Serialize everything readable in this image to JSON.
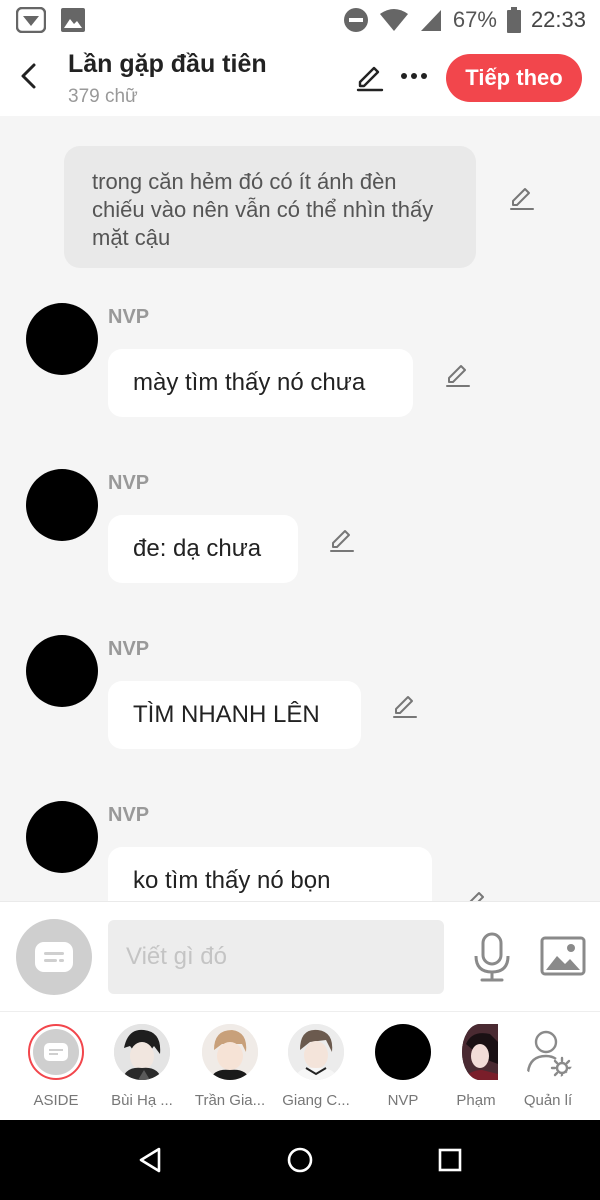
{
  "status_bar": {
    "battery": "67%",
    "time": "22:33"
  },
  "header": {
    "title": "Lần gặp đầu tiên",
    "subtitle": "379 chữ",
    "next_label": "Tiếp theo"
  },
  "chat": {
    "narration": "trong căn hẻm đó có ít ánh đèn chiếu vào nên vẫn có thể nhìn thấy mặt cậu",
    "messages": [
      {
        "sender": "NVP",
        "text": "mày tìm thấy nó chưa"
      },
      {
        "sender": "NVP",
        "text": "đe: dạ chưa"
      },
      {
        "sender": "NVP",
        "text": "TÌM NHANH LÊN"
      },
      {
        "sender": "NVP",
        "text": "ko tìm thấy nó bọn"
      }
    ]
  },
  "input": {
    "placeholder": "Viết gì đó"
  },
  "characters": [
    {
      "label": "ASIDE"
    },
    {
      "label": "Bùi Hạ ..."
    },
    {
      "label": "Trần Gia..."
    },
    {
      "label": "Giang C..."
    },
    {
      "label": "NVP"
    },
    {
      "label": "Phạm"
    },
    {
      "label": "Quản lí"
    }
  ],
  "colors": {
    "accent": "#f2464c",
    "bubble": "#ffffff",
    "narration_bg": "#e9e9e9"
  }
}
